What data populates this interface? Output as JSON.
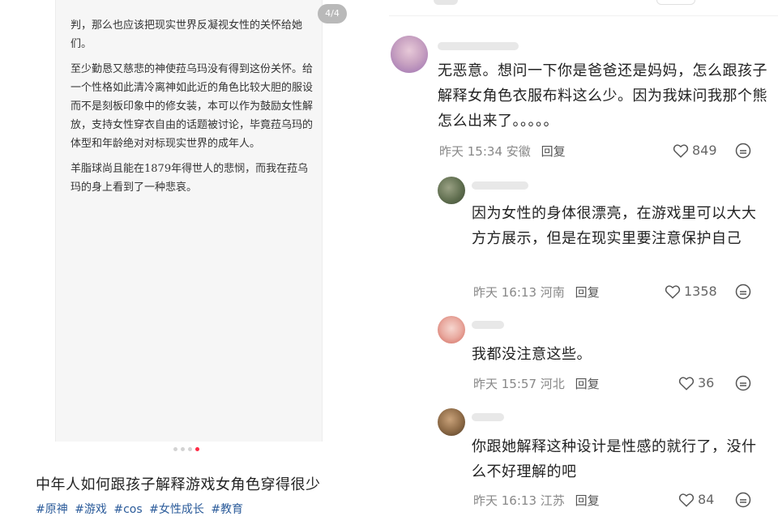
{
  "left": {
    "page_indicator": "4/4",
    "article_paragraphs": [
      "判，那么也应该把现实世界反凝视女性的关怀给她们。",
      "至少勤恳又慈悲的神使菈乌玛没有得到这份关怀。给一个性格如此清冷离神如此近的角色比较大胆的服设而不是刻板印象中的修女装，本可以作为鼓励女性解放，支持女性穿衣自由的话题被讨论，毕竟菈乌玛的体型和年龄绝对对标现实世界的成年人。",
      "羊脂球尚且能在1879年得世人的悲悯，而我在菈乌玛的身上看到了一种悲哀。"
    ],
    "post_title": "中年人如何跟孩子解释游戏女角色穿得很少",
    "tags": [
      "#原神",
      "#游戏",
      "#cos",
      "#女性成长",
      "#教育"
    ]
  },
  "comments": [
    {
      "text": "无恶意。想问一下你是爸爸还是妈妈，怎么跟孩子解释女角色衣服布料这么少。因为我妹问我那个熊怎么出来了。。。。。",
      "time": "昨天 15:34",
      "location": "安徽",
      "reply": "回复",
      "likes": "849"
    },
    {
      "text": "因为女性的身体很漂亮，在游戏里可以大大方方展示，但是在现实里要注意保护自己",
      "time": "昨天 16:13",
      "location": "河南",
      "reply": "回复",
      "likes": "1358"
    },
    {
      "text": "我都没注意这些。",
      "time": "昨天 15:57",
      "location": "河北",
      "reply": "回复",
      "likes": "36"
    },
    {
      "text": "你跟她解释这种设计是性感的就行了，没什么不好理解的吧",
      "time": "昨天 16:13",
      "location": "江苏",
      "reply": "回复",
      "likes": "84"
    }
  ],
  "colors": {
    "accent_dot": "#ff2a45",
    "tag_link": "#2b5b9a",
    "meta_gray": "#888888"
  },
  "icons": [
    "heart-icon",
    "more-icon"
  ]
}
